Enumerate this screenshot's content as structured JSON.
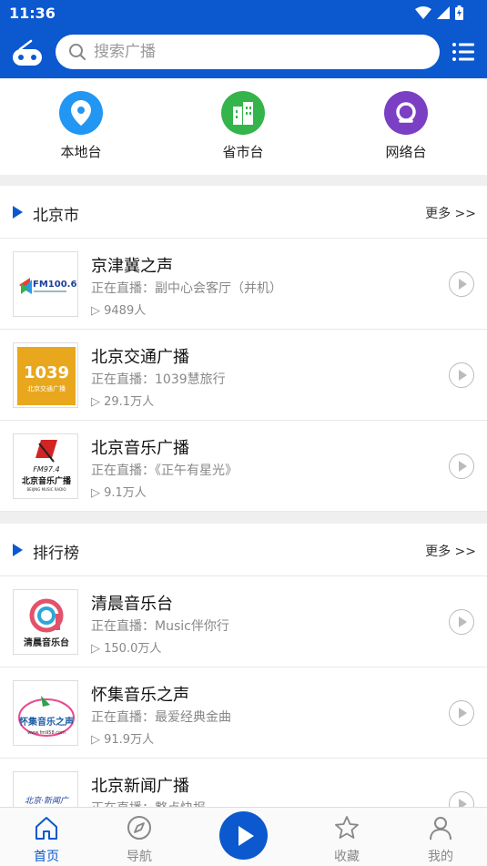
{
  "status": {
    "time": "11:36"
  },
  "search": {
    "placeholder": "搜索广播"
  },
  "categories": [
    {
      "label": "本地台",
      "color": "#2196f3",
      "icon": "location-pin-icon"
    },
    {
      "label": "省市台",
      "color": "#34b44a",
      "icon": "building-icon"
    },
    {
      "label": "网络台",
      "color": "#7b3fc4",
      "icon": "q-circle-icon"
    }
  ],
  "sections": [
    {
      "title": "北京市",
      "more": "更多 >>",
      "items": [
        {
          "name": "京津冀之声",
          "now": "正在直播：副中心会客厅（并机）",
          "count": "▷ 9489人",
          "logo_text": "FM100.6"
        },
        {
          "name": "北京交通广播",
          "now": "正在直播：1039慧旅行",
          "count": "▷ 29.1万人",
          "logo_text": "1039",
          "logo_sub": "北京交通广播"
        },
        {
          "name": "北京音乐广播",
          "now": "正在直播：《正午有星光》",
          "count": "▷ 9.1万人",
          "logo_text": "FM97.4",
          "logo_sub": "北京音乐广播",
          "logo_en": "BEIJING MUSIC RADIO"
        }
      ]
    },
    {
      "title": "排行榜",
      "more": "更多 >>",
      "items": [
        {
          "name": "清晨音乐台",
          "now": "正在直播：Music伴你行",
          "count": "▷ 150.0万人",
          "logo_text": "清晨音乐台"
        },
        {
          "name": "怀集音乐之声",
          "now": "正在直播：最爱经典金曲",
          "count": "▷ 91.9万人",
          "logo_text": "怀集音乐之声",
          "logo_sub": "www.fm958.com"
        },
        {
          "name": "北京新闻广播",
          "now": "正在直播：整点快报",
          "count": "",
          "logo_text": "北京·新闻广"
        }
      ]
    }
  ],
  "bottom_nav": [
    {
      "label": "首页",
      "icon": "home-icon",
      "active": true
    },
    {
      "label": "导航",
      "icon": "compass-icon",
      "active": false
    },
    {
      "label": "",
      "icon": "play-icon",
      "active": false
    },
    {
      "label": "收藏",
      "icon": "star-icon",
      "active": false
    },
    {
      "label": "我的",
      "icon": "user-icon",
      "active": false
    }
  ],
  "colors": {
    "primary": "#0b58cf",
    "background": "#efefef"
  }
}
